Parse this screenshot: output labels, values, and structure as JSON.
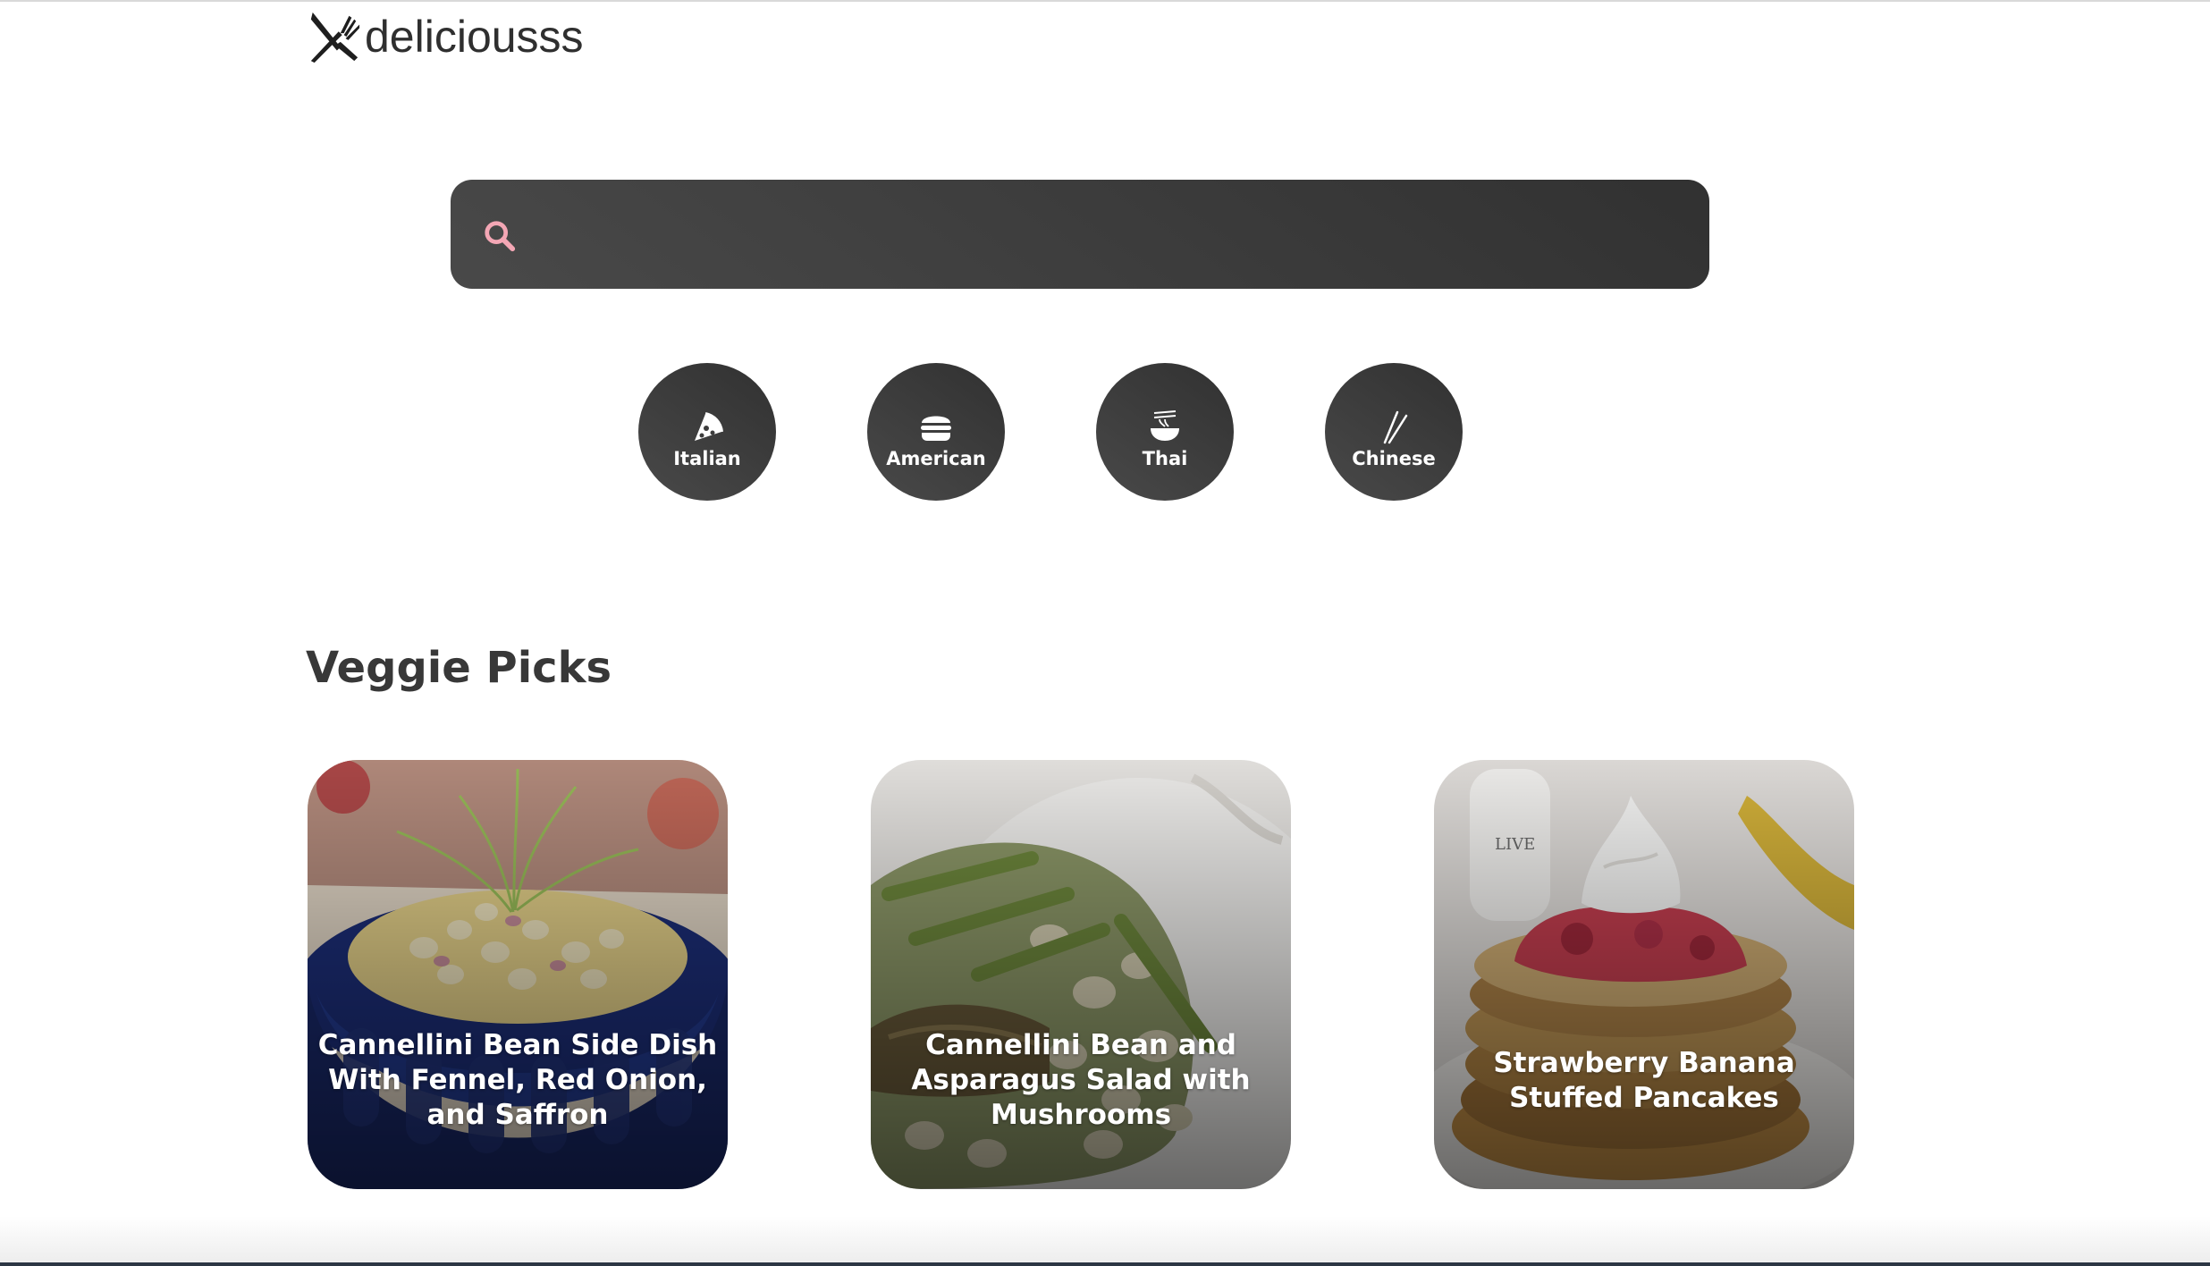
{
  "header": {
    "logo_text": "deliciousss",
    "logo_icon": "utensils-crossed-icon"
  },
  "search": {
    "placeholder": "",
    "value": "",
    "icon": "search-icon",
    "icon_color": "#f4a7b5"
  },
  "categories": [
    {
      "label": "Italian",
      "icon": "pizza-icon"
    },
    {
      "label": "American",
      "icon": "hamburger-icon"
    },
    {
      "label": "Thai",
      "icon": "noodle-bowl-icon"
    },
    {
      "label": "Chinese",
      "icon": "chopsticks-icon"
    }
  ],
  "veggie": {
    "title": "Veggie Picks",
    "cards": [
      {
        "title": "Cannellini Bean Side Dish With Fennel, Red Onion, and Saffron"
      },
      {
        "title": "Cannellini Bean and Asparagus Salad with Mushrooms"
      },
      {
        "title": "Strawberry Banana Stuffed Pancakes"
      }
    ]
  }
}
